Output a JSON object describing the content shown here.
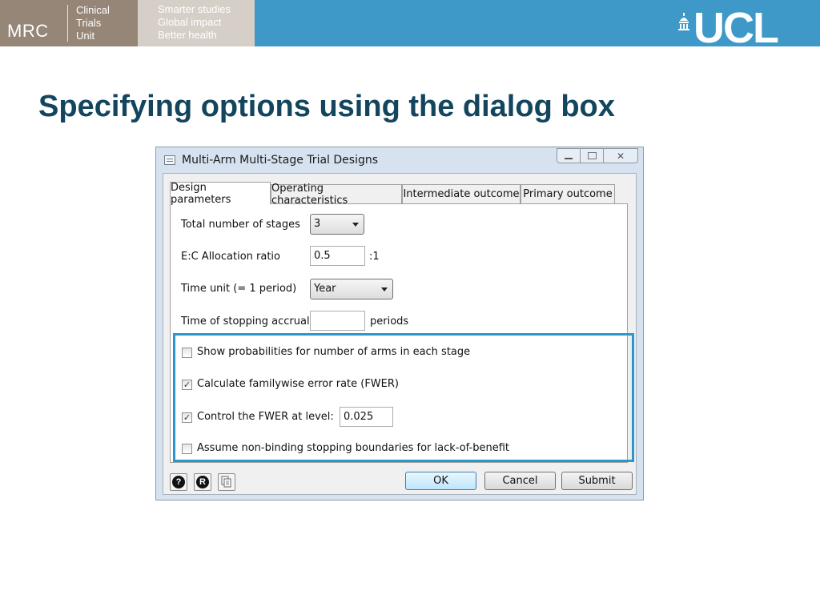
{
  "header": {
    "mrc_logo": "MRC",
    "mrc_unit_lines": [
      "Clinical",
      "Trials",
      "Unit"
    ],
    "tagline_lines": [
      "Smarter studies",
      "Global impact",
      "Better health"
    ],
    "ucl_logo": "UCL",
    "colors": {
      "bar": "#3e99c8",
      "mrc": "#958678",
      "tagline": "#d6cfc8"
    }
  },
  "slide": {
    "title": "Specifying options using the dialog box",
    "title_color": "#13465e"
  },
  "dialog": {
    "title": "Multi-Arm Multi-Stage Trial Designs",
    "window_icons": [
      "minimize-icon",
      "maximize-icon",
      "close-icon"
    ],
    "close_glyph": "✕",
    "tabs": [
      {
        "label": "Design parameters",
        "active": true
      },
      {
        "label": "Operating characteristics",
        "active": false
      },
      {
        "label": "Intermediate outcome",
        "active": false
      },
      {
        "label": "Primary outcome",
        "active": false
      }
    ],
    "fields": {
      "stages": {
        "label": "Total number of stages",
        "value": "3"
      },
      "allocation": {
        "label": "E:C Allocation ratio",
        "value": "0.5",
        "suffix": ":1"
      },
      "time_unit": {
        "label": "Time unit (= 1 period)",
        "value": "Year"
      },
      "stop_accrual": {
        "label": "Time of stopping accrual",
        "value": "",
        "suffix": "periods"
      }
    },
    "options": [
      {
        "label": "Show probabilities for number of arms in each stage",
        "checked": false
      },
      {
        "label": "Calculate familywise error rate (FWER)",
        "checked": true
      },
      {
        "label": "Control the FWER at level:",
        "checked": true
      },
      {
        "label": "Assume non-binding stopping boundaries for lack-of-benefit",
        "checked": false
      }
    ],
    "fwer_level": "0.025",
    "check_glyph": "✓",
    "highlight_color": "#2a97cd",
    "toolbar_icons": [
      {
        "name": "help-icon",
        "glyph": "?"
      },
      {
        "name": "r-icon",
        "glyph": "R"
      },
      {
        "name": "copy-icon",
        "glyph": ""
      }
    ],
    "buttons": {
      "ok": "OK",
      "cancel": "Cancel",
      "submit": "Submit"
    }
  }
}
